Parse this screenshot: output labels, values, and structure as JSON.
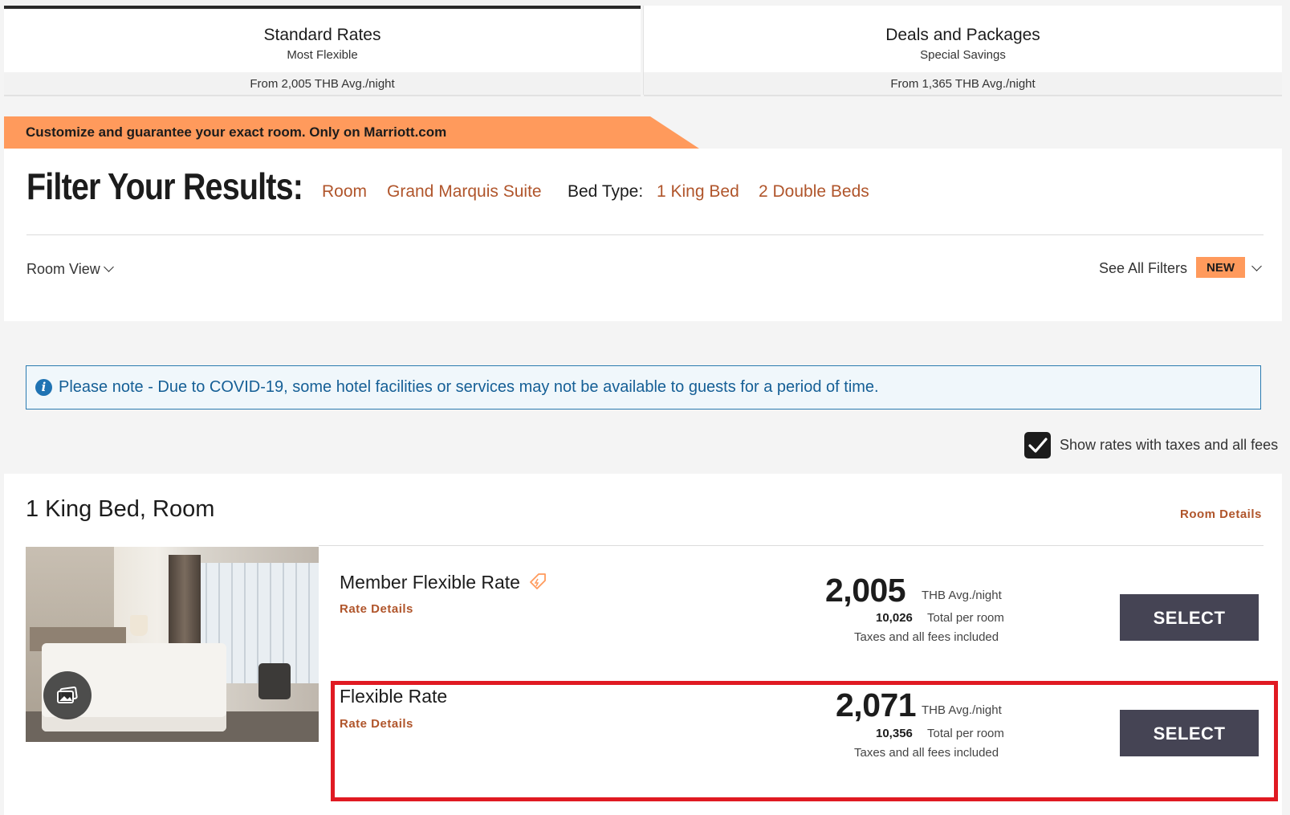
{
  "tabs": [
    {
      "title": "Standard Rates",
      "subtitle": "Most Flexible",
      "price": "From 2,005 THB Avg./night"
    },
    {
      "title": "Deals and Packages",
      "subtitle": "Special Savings",
      "price": "From 1,365 THB Avg./night"
    }
  ],
  "promo": {
    "text": "Customize and guarantee your exact room. Only on Marriott.com"
  },
  "filter": {
    "title": "Filter Your Results:",
    "room_links": [
      "Room",
      "Grand Marquis Suite"
    ],
    "bed_type_label": "Bed Type:",
    "bed_links": [
      "1 King Bed",
      "2 Double Beds"
    ],
    "room_view": "Room View",
    "see_all": "See All Filters",
    "new_badge": "NEW"
  },
  "note": {
    "icon": "i",
    "text": "Please note - Due to COVID-19, some hotel facilities or services may not be available to guests for a period of time."
  },
  "tax_toggle": {
    "label": "Show rates with taxes and all fees",
    "checked": true
  },
  "room": {
    "title": "1 King Bed, Room",
    "details_link": "Room Details",
    "rates": [
      {
        "name": "Member Flexible Rate",
        "details": "Rate Details",
        "price": "2,005",
        "unit": "THB Avg./night",
        "total": "10,026",
        "total_label": "Total per room",
        "tax_note": "Taxes and all fees included",
        "button": "SELECT"
      },
      {
        "name": "Flexible Rate",
        "details": "Rate Details",
        "price": "2,071",
        "unit": "THB Avg./night",
        "total": "10,356",
        "total_label": "Total per room",
        "tax_note": "Taxes and all fees included",
        "button": "SELECT"
      }
    ]
  },
  "colors": {
    "accent": "#b0552b",
    "promo": "#ff9a5c",
    "button": "#454454",
    "highlight": "#e01a22",
    "note_text": "#155f96"
  }
}
